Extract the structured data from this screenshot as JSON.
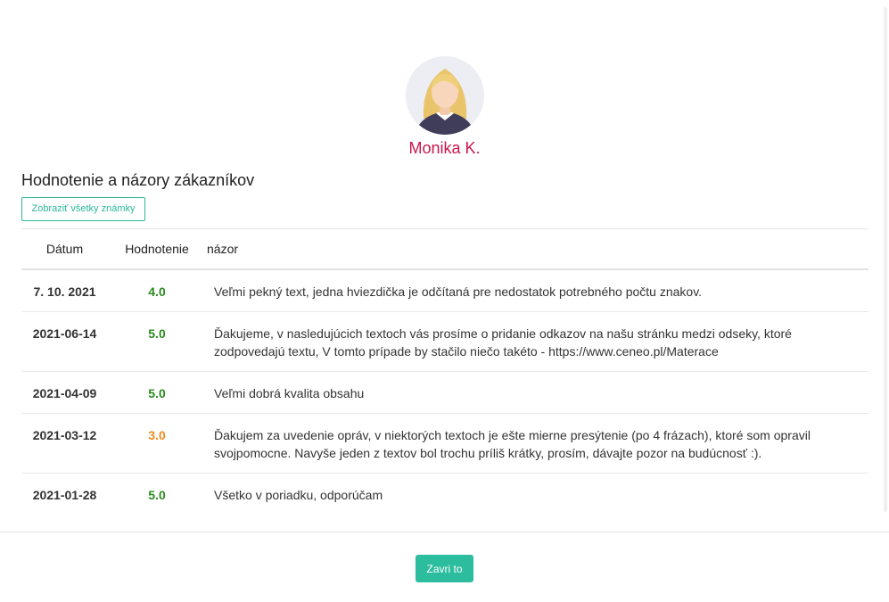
{
  "profile": {
    "name": "Monika K."
  },
  "section": {
    "title": "Hodnotenie a názory zákazníkov",
    "show_all_label": "Zobraziť všetky známky"
  },
  "table": {
    "headers": {
      "date": "Dátum",
      "rating": "Hodnotenie",
      "opinion": "názor"
    },
    "rows": [
      {
        "date": "7. 10. 2021",
        "rating": "4.0",
        "rating_color": "#2a8a1f",
        "text": "Veľmi pekný text, jedna hviezdička je odčítaná pre nedostatok potrebného počtu znakov."
      },
      {
        "date": "2021-06-14",
        "rating": "5.0",
        "rating_color": "#2a8a1f",
        "text": "Ďakujeme, v nasledujúcich textoch vás prosíme o pridanie odkazov na našu stránku medzi odseky, ktoré zodpovedajú textu, V tomto prípade by stačilo niečo takéto - https://www.ceneo.pl/Materace"
      },
      {
        "date": "2021-04-09",
        "rating": "5.0",
        "rating_color": "#2a8a1f",
        "text": "Veľmi dobrá kvalita obsahu"
      },
      {
        "date": "2021-03-12",
        "rating": "3.0",
        "rating_color": "#ef8a1d",
        "text": "Ďakujem za uvedenie opráv, v niektorých textoch je ešte mierne presýtenie (po 4 frázach), ktoré som opravil svojpomocne. Navyše jeden z textov bol trochu príliš krátky, prosím, dávajte pozor na budúcnosť :)."
      },
      {
        "date": "2021-01-28",
        "rating": "5.0",
        "rating_color": "#2a8a1f",
        "text": "Všetko v poriadku, odporúčam"
      }
    ]
  },
  "footer": {
    "close_label": "Zavri to"
  },
  "colors": {
    "accent": "#2cbc9e",
    "name": "#c8174a",
    "good": "#2a8a1f",
    "medium": "#ef8a1d"
  }
}
